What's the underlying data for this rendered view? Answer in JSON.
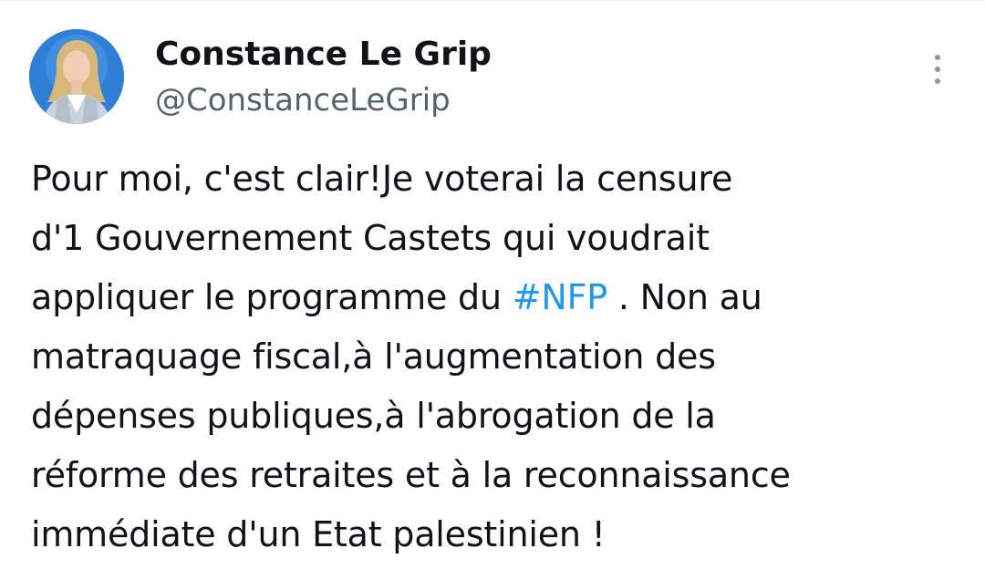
{
  "author": {
    "display_name": "Constance Le Grip",
    "handle": "@ConstanceLeGrip",
    "avatar_alt": "avatar"
  },
  "menu": {
    "icon": "more-vertical-icon"
  },
  "tweet": {
    "line1": "Pour moi, c'est clair!Je voterai la censure",
    "line2": "d'1 Gouvernement Castets qui voudrait",
    "line3_before": "appliquer le programme du ",
    "hashtag": "#NFP",
    "line3_after": " . Non au",
    "line4": "matraquage fiscal,à l'augmentation des",
    "line5": "dépenses publiques,à l'abrogation de la",
    "line6": "réforme des retraites et à la reconnaissance",
    "line7": "immédiate d'un Etat palestinien !"
  },
  "colors": {
    "text": "#0f1419",
    "secondary": "#536471",
    "link": "#1d9bf0",
    "avatar_bg": "#2f7fd6"
  }
}
